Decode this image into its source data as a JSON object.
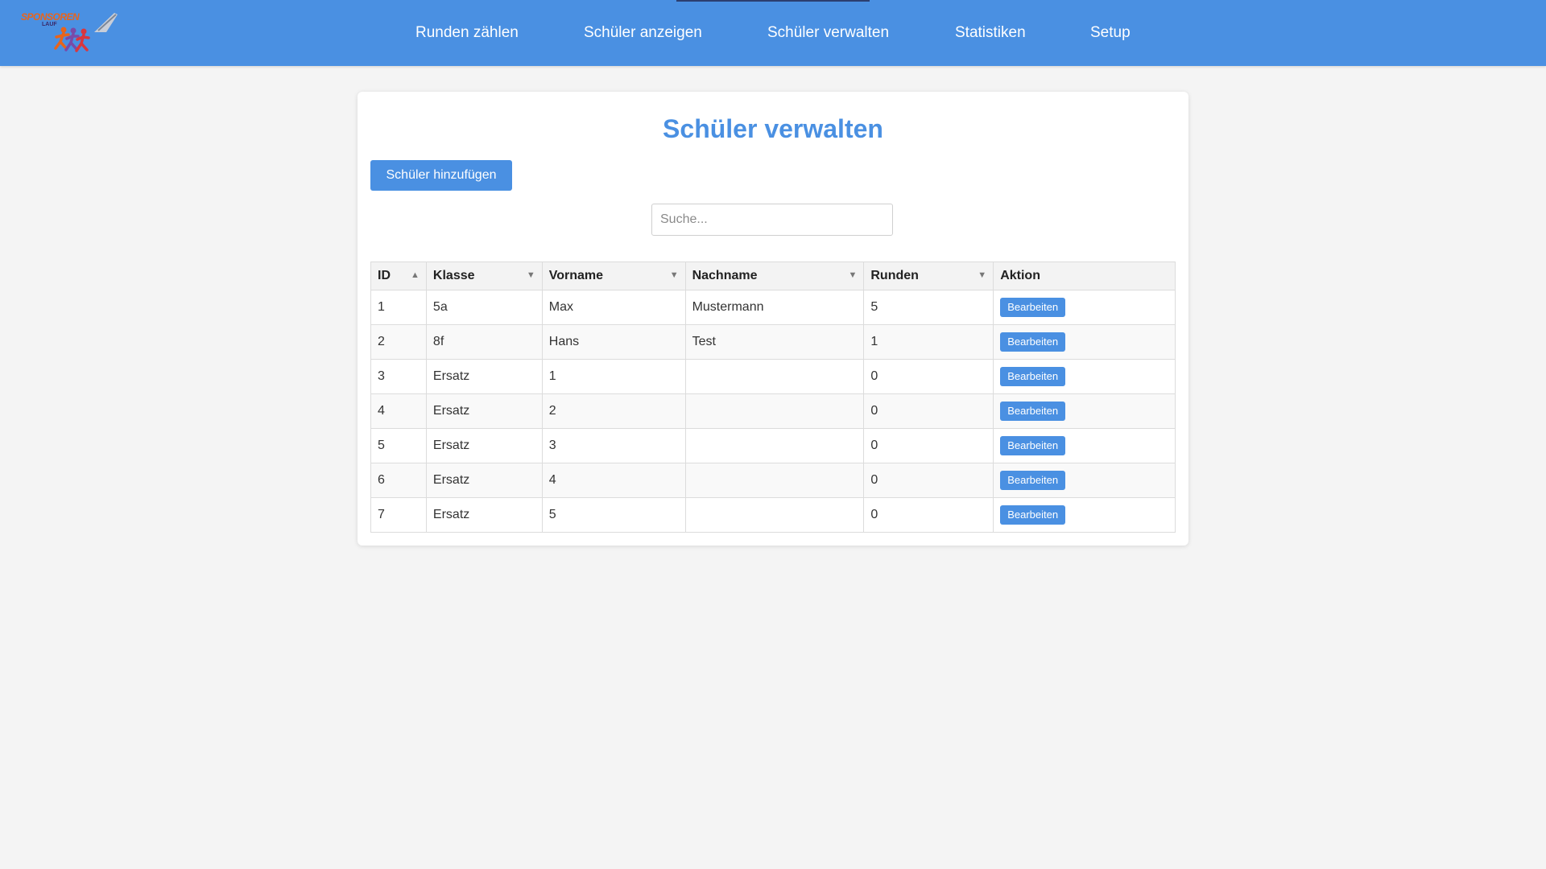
{
  "header": {
    "logo_text": "SPONSOREN",
    "logo_sub": "LAUF",
    "nav": [
      {
        "label": "Runden zählen"
      },
      {
        "label": "Schüler anzeigen"
      },
      {
        "label": "Schüler verwalten"
      },
      {
        "label": "Statistiken"
      },
      {
        "label": "Setup"
      }
    ]
  },
  "main": {
    "title": "Schüler verwalten",
    "add_button": "Schüler hinzufügen",
    "search_placeholder": "Suche...",
    "search_value": "",
    "table": {
      "columns": [
        {
          "label": "ID",
          "sort_icon": "▲"
        },
        {
          "label": "Klasse",
          "sort_icon": "▼"
        },
        {
          "label": "Vorname",
          "sort_icon": "▼"
        },
        {
          "label": "Nachname",
          "sort_icon": "▼"
        },
        {
          "label": "Runden",
          "sort_icon": "▼"
        },
        {
          "label": "Aktion"
        }
      ],
      "action_label": "Bearbeiten",
      "rows": [
        {
          "id": "1",
          "klasse": "5a",
          "vorname": "Max",
          "nachname": "Mustermann",
          "runden": "5"
        },
        {
          "id": "2",
          "klasse": "8f",
          "vorname": "Hans",
          "nachname": "Test",
          "runden": "1"
        },
        {
          "id": "3",
          "klasse": "Ersatz",
          "vorname": "1",
          "nachname": "",
          "runden": "0"
        },
        {
          "id": "4",
          "klasse": "Ersatz",
          "vorname": "2",
          "nachname": "",
          "runden": "0"
        },
        {
          "id": "5",
          "klasse": "Ersatz",
          "vorname": "3",
          "nachname": "",
          "runden": "0"
        },
        {
          "id": "6",
          "klasse": "Ersatz",
          "vorname": "4",
          "nachname": "",
          "runden": "0"
        },
        {
          "id": "7",
          "klasse": "Ersatz",
          "vorname": "5",
          "nachname": "",
          "runden": "0"
        }
      ]
    }
  },
  "colors": {
    "primary": "#4a90e2",
    "background": "#f4f4f4",
    "logo_orange": "#e8641b"
  }
}
